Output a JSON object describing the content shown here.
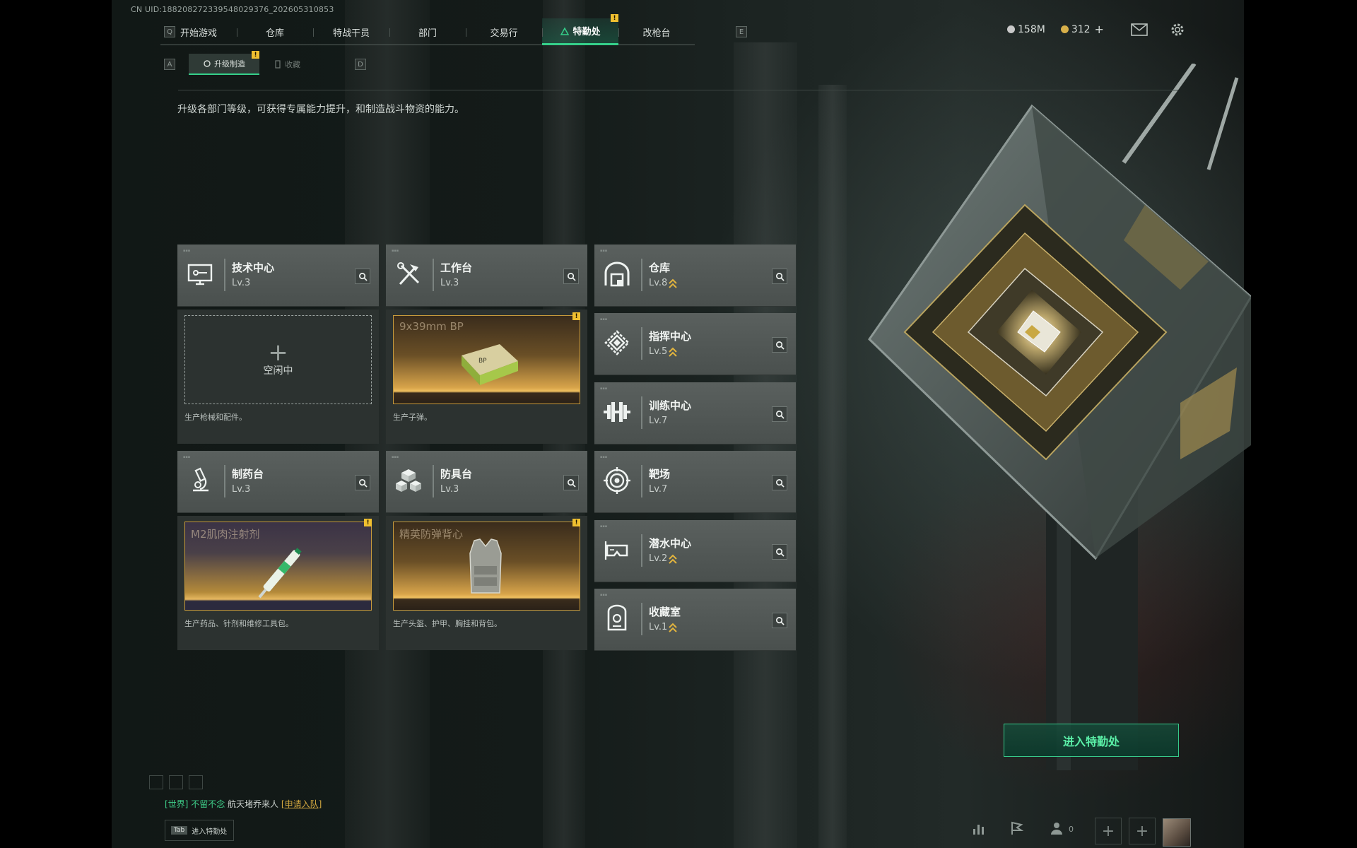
{
  "uid": "CN UID:1882082723395480293​76_202605310853",
  "nav": {
    "left_key": "Q",
    "right_key": "E",
    "tabs": [
      {
        "label": "开始游戏",
        "active": false
      },
      {
        "label": "仓库",
        "active": false
      },
      {
        "label": "特战干员",
        "active": false
      },
      {
        "label": "部门",
        "active": false
      },
      {
        "label": "交易行",
        "active": false
      },
      {
        "label": "特勤处",
        "active": true,
        "badge": "!"
      },
      {
        "label": "改枪台",
        "active": false
      }
    ]
  },
  "currency": {
    "silver_value": "158M",
    "silver_color": "#c9c9c9",
    "gold_value": "312",
    "gold_color": "#d8b04a",
    "gold_add": "+"
  },
  "icons": {
    "mail": "mail-icon",
    "settings": "gear-icon"
  },
  "subtabs": {
    "left_key": "A",
    "right_key": "D",
    "items": [
      {
        "label": "升级制造",
        "active": true,
        "badge": "!"
      },
      {
        "label": "收藏",
        "active": false
      }
    ]
  },
  "description": "升级各部门等级，可获得专属能力提升，和制造战斗物资的能力。",
  "departments": [
    {
      "name": "技术中心",
      "level": "Lv.3",
      "icon": "monitor-icon",
      "upgradeable": false,
      "slot": {
        "state": "empty",
        "label": "空闲中"
      },
      "caption": "生产枪械和配件。"
    },
    {
      "name": "工作台",
      "level": "Lv.3",
      "icon": "tools-icon",
      "upgradeable": false,
      "slot": {
        "state": "item",
        "item_name": "9x39mm BP",
        "badge": "!"
      },
      "caption": "生产子弹。"
    },
    {
      "name": "制药台",
      "level": "Lv.3",
      "icon": "microscope-icon",
      "upgradeable": false,
      "slot": {
        "state": "item",
        "item_name": "M2肌肉注射剂",
        "badge": "!"
      },
      "caption": "生产药品、针剂和维修工具包。"
    },
    {
      "name": "防具台",
      "level": "Lv.3",
      "icon": "boxes-icon",
      "upgradeable": false,
      "slot": {
        "state": "item",
        "item_name": "精英防弹背心",
        "badge": "!"
      },
      "caption": "生产头盔、护甲、胸挂和背包。"
    },
    {
      "name": "仓库",
      "level": "Lv.8",
      "icon": "warehouse-icon",
      "upgradeable": true
    },
    {
      "name": "指挥中心",
      "level": "Lv.5",
      "icon": "chip-icon",
      "upgradeable": true
    },
    {
      "name": "训练中心",
      "level": "Lv.7",
      "icon": "dumbbell-icon",
      "upgradeable": false
    },
    {
      "name": "靶场",
      "level": "Lv.7",
      "icon": "target-icon",
      "upgradeable": false
    },
    {
      "name": "潜水中心",
      "level": "Lv.2",
      "icon": "goggles-icon",
      "upgradeable": true
    },
    {
      "name": "收藏室",
      "level": "Lv.1",
      "icon": "vault-icon",
      "upgradeable": true
    }
  ],
  "enter_button": "进入特勤处",
  "chat": {
    "channel": "[世界]",
    "sender": "不留不念",
    "message": "航天堵乔来人",
    "join": "[申请入队]"
  },
  "tab_hint": {
    "key": "Tab",
    "label": "进入特勤处"
  },
  "friends_count": "0"
}
